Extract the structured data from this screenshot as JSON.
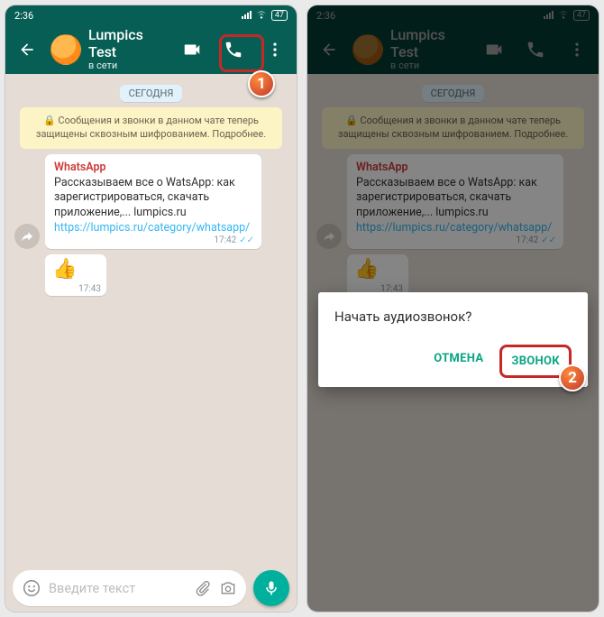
{
  "status": {
    "time": "2:36",
    "battery": "47"
  },
  "appbar": {
    "contact": "Lumpics Test",
    "status": "в сети"
  },
  "chat": {
    "day": "СЕГОДНЯ",
    "encryption": "🔒 Сообщения и звонки в данном чате теперь защищены сквозным шифрованием. Подробнее.",
    "msg": {
      "from": "WhatsApp",
      "body": "Рассказываем все о WatsApp: как зарегистрироваться, скачать приложение,... lumpics.ru",
      "link": "https://lumpics.ru/category/whatsapp/",
      "time": "17:42"
    },
    "thumb": {
      "emoji": "👍",
      "time": "17:43"
    }
  },
  "input": {
    "placeholder": "Введите текст"
  },
  "dialog": {
    "title": "Начать аудиозвонок?",
    "cancel": "ОТМЕНА",
    "confirm": "ЗВОНОК"
  },
  "steps": {
    "one": "1",
    "two": "2"
  }
}
